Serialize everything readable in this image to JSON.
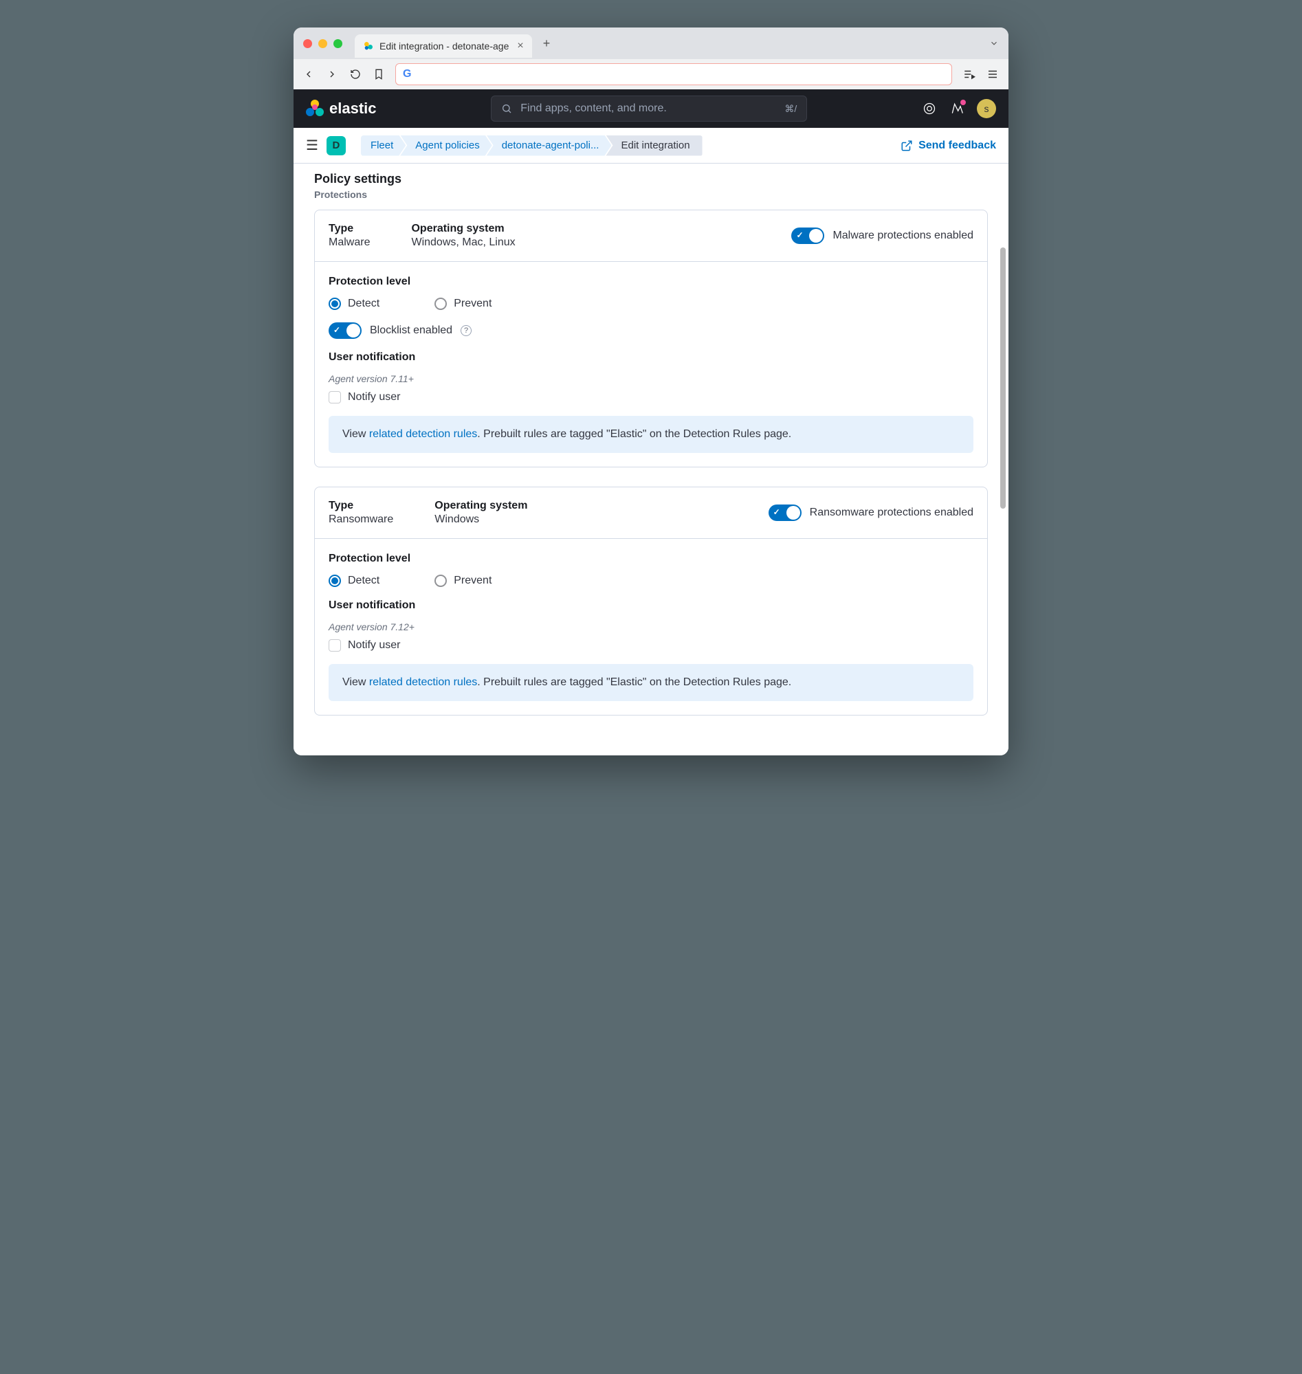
{
  "browser": {
    "tab_title": "Edit integration - detonate-age",
    "url_placeholder": ""
  },
  "header": {
    "brand": "elastic",
    "search_placeholder": "Find apps, content, and more.",
    "search_kbd": "⌘/",
    "avatar_letter": "s"
  },
  "subheader": {
    "space_letter": "D",
    "breadcrumbs": [
      "Fleet",
      "Agent policies",
      "detonate-agent-poli...",
      "Edit integration"
    ],
    "feedback": "Send feedback"
  },
  "page": {
    "title": "Policy settings",
    "section": "Protections"
  },
  "labels": {
    "type": "Type",
    "os": "Operating system",
    "protection_level": "Protection level",
    "detect": "Detect",
    "prevent": "Prevent",
    "blocklist": "Blocklist enabled",
    "user_notification": "User notification",
    "notify_user": "Notify user",
    "callout_prefix": "View ",
    "callout_link": "related detection rules",
    "callout_suffix": ". Prebuilt rules are tagged \"Elastic\" on the Detection Rules page."
  },
  "malware": {
    "type": "Malware",
    "os": "Windows, Mac, Linux",
    "toggle_label": "Malware protections enabled",
    "version_hint": "Agent version 7.11+"
  },
  "ransomware": {
    "type": "Ransomware",
    "os": "Windows",
    "toggle_label": "Ransomware protections enabled",
    "version_hint": "Agent version 7.12+"
  }
}
